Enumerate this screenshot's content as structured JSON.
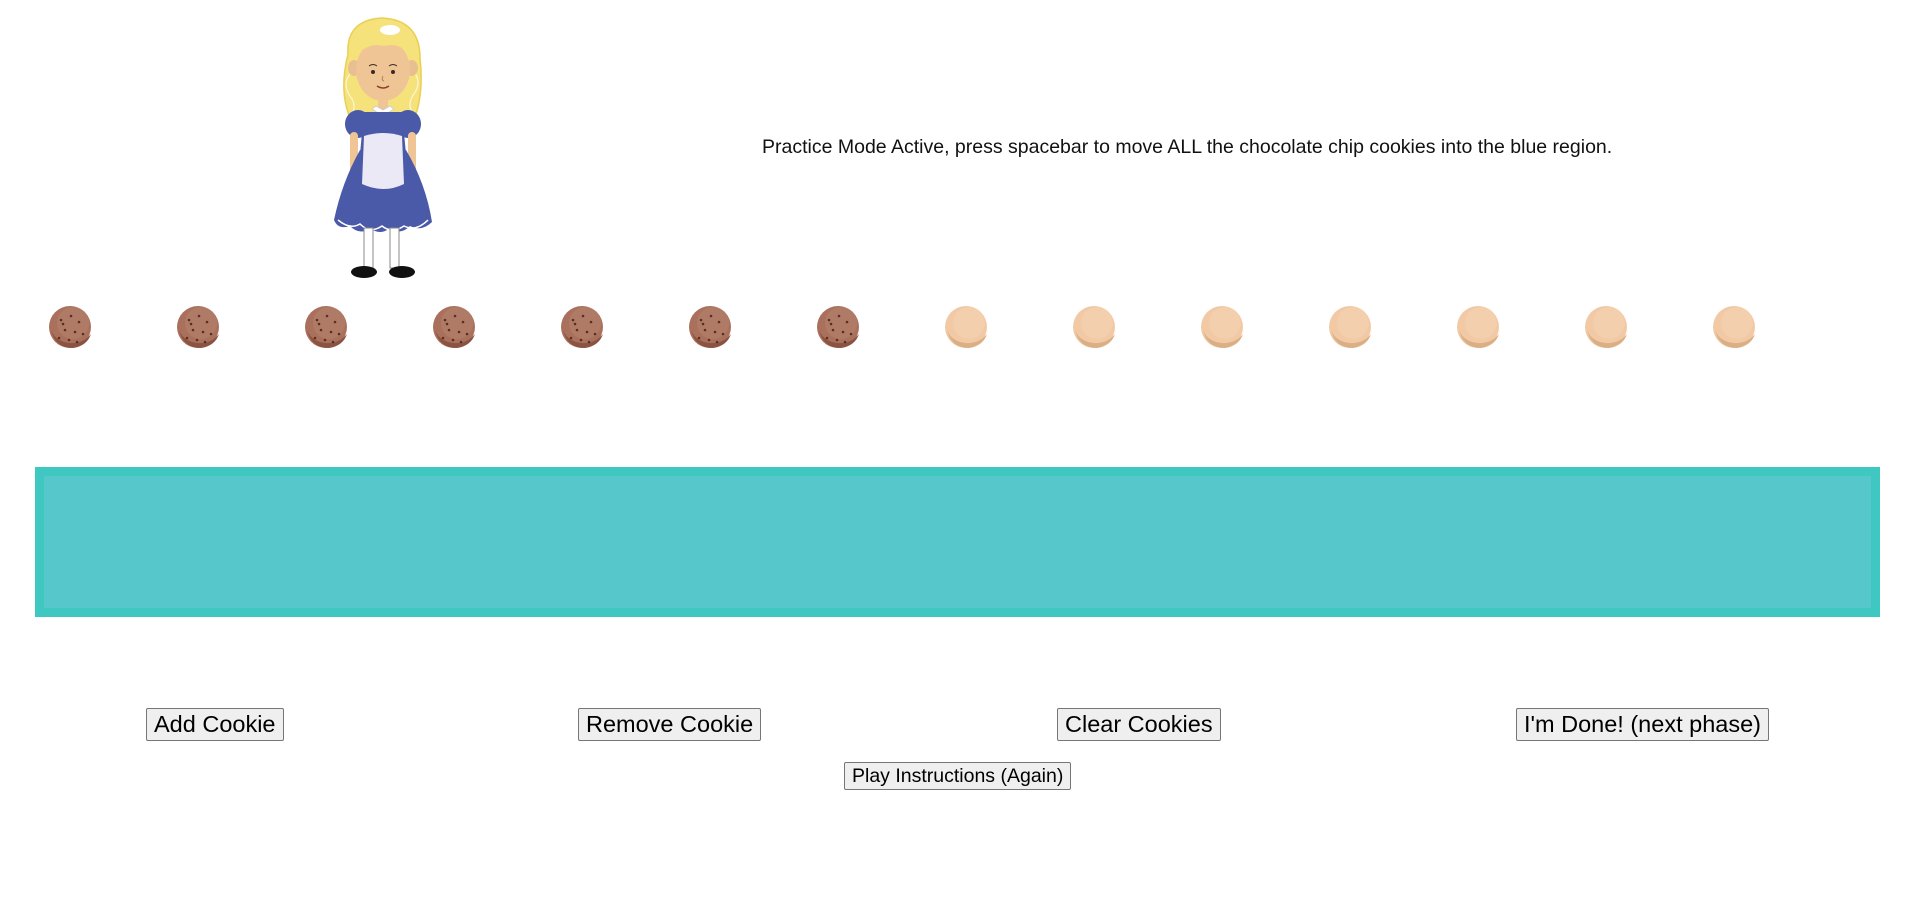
{
  "instructions_text": "Practice Mode Active, press spacebar to move ALL the chocolate chip cookies into the blue region.",
  "cookies": [
    {
      "kind": "chocolate-chip"
    },
    {
      "kind": "chocolate-chip"
    },
    {
      "kind": "chocolate-chip"
    },
    {
      "kind": "chocolate-chip"
    },
    {
      "kind": "chocolate-chip"
    },
    {
      "kind": "chocolate-chip"
    },
    {
      "kind": "chocolate-chip"
    },
    {
      "kind": "plain"
    },
    {
      "kind": "plain"
    },
    {
      "kind": "plain"
    },
    {
      "kind": "plain"
    },
    {
      "kind": "plain"
    },
    {
      "kind": "plain"
    },
    {
      "kind": "plain"
    }
  ],
  "colors": {
    "drop_zone_fill": "#56c8cc",
    "drop_zone_border": "#3fc8c2",
    "chocolate_cookie": "#a9715c",
    "plain_cookie": "#f1c9a4",
    "dress": "#4a5aa8",
    "hair": "#f6e27a"
  },
  "buttons": {
    "add_cookie": "Add Cookie",
    "remove_cookie": "Remove Cookie",
    "clear_cookies": "Clear Cookies",
    "done": "I'm Done! (next phase)",
    "play_instructions": "Play Instructions (Again)"
  },
  "icons": {
    "character": "girl-character-icon",
    "chocolate_cookie": "chocolate-chip-cookie-icon",
    "plain_cookie": "plain-cookie-icon"
  }
}
